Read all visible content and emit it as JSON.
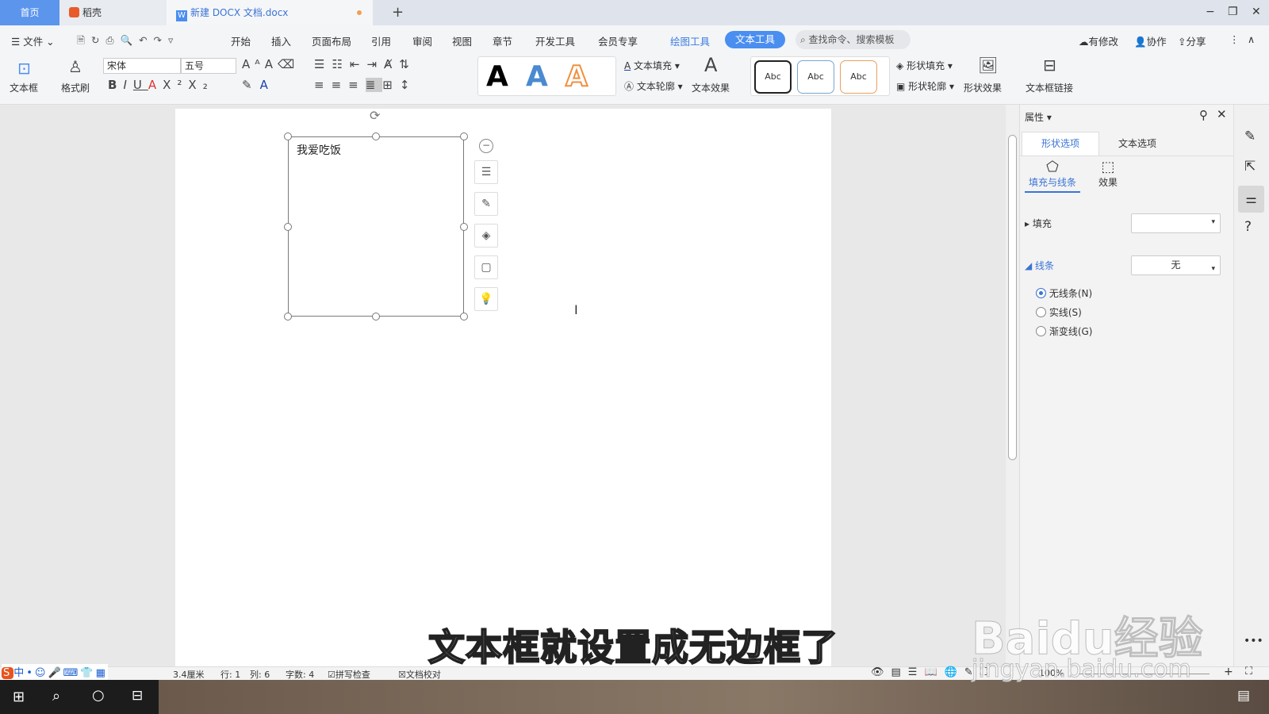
{
  "tabs": {
    "home": "首页",
    "daoke": "稻壳",
    "doc": "新建 DOCX 文档.docx",
    "new": "+"
  },
  "window": {
    "min": "−",
    "restore": "❐",
    "close": "✕"
  },
  "menu": {
    "file": "文件",
    "items": [
      "开始",
      "插入",
      "页面布局",
      "引用",
      "审阅",
      "视图",
      "章节",
      "开发工具",
      "会员专享"
    ],
    "drawing_tools": "绘图工具",
    "text_tools": "文本工具",
    "search": "查找命令、搜索模板",
    "modified": "有修改",
    "collab": "协作",
    "share": "分享"
  },
  "ribbon": {
    "textbox": "文本框",
    "format_painter": "格式刷",
    "font": "宋体",
    "size": "五号",
    "text_fill": "文本填充",
    "text_outline": "文本轮廓",
    "text_effect": "文本效果",
    "styles": [
      "Abc",
      "Abc",
      "Abc"
    ],
    "shape_fill": "形状填充",
    "shape_outline": "形状轮廓",
    "shape_effect": "形状效果",
    "textbox_link": "文本框链接",
    "wordart": [
      "A",
      "A",
      "A"
    ]
  },
  "document": {
    "textbox_text": "我爱吃饭"
  },
  "panel": {
    "title": "属性",
    "tab_shape": "形状选项",
    "tab_text": "文本选项",
    "sub_fill_line": "填充与线条",
    "sub_effect": "效果",
    "fill_label": "填充",
    "fill_value": "",
    "line_label": "线条",
    "line_value": "无",
    "radios": [
      {
        "label": "无线条(N)",
        "checked": true
      },
      {
        "label": "实线(S)",
        "checked": false
      },
      {
        "label": "渐变线(G)",
        "checked": false
      }
    ]
  },
  "status": {
    "position": "3.4厘米",
    "row": "行: 1",
    "col": "列: 6",
    "words": "字数: 4",
    "spell": "拼写检查",
    "proof": "文档校对",
    "zoom": "100%"
  },
  "overlay": {
    "subtitle": "文本框就设置成无边框了",
    "watermark": "Baidu经验",
    "watermark_url": "jingyan.baidu.com"
  },
  "colors": {
    "accent": "#4a8ef0",
    "text_tools_bg": "#4a8ef0"
  }
}
